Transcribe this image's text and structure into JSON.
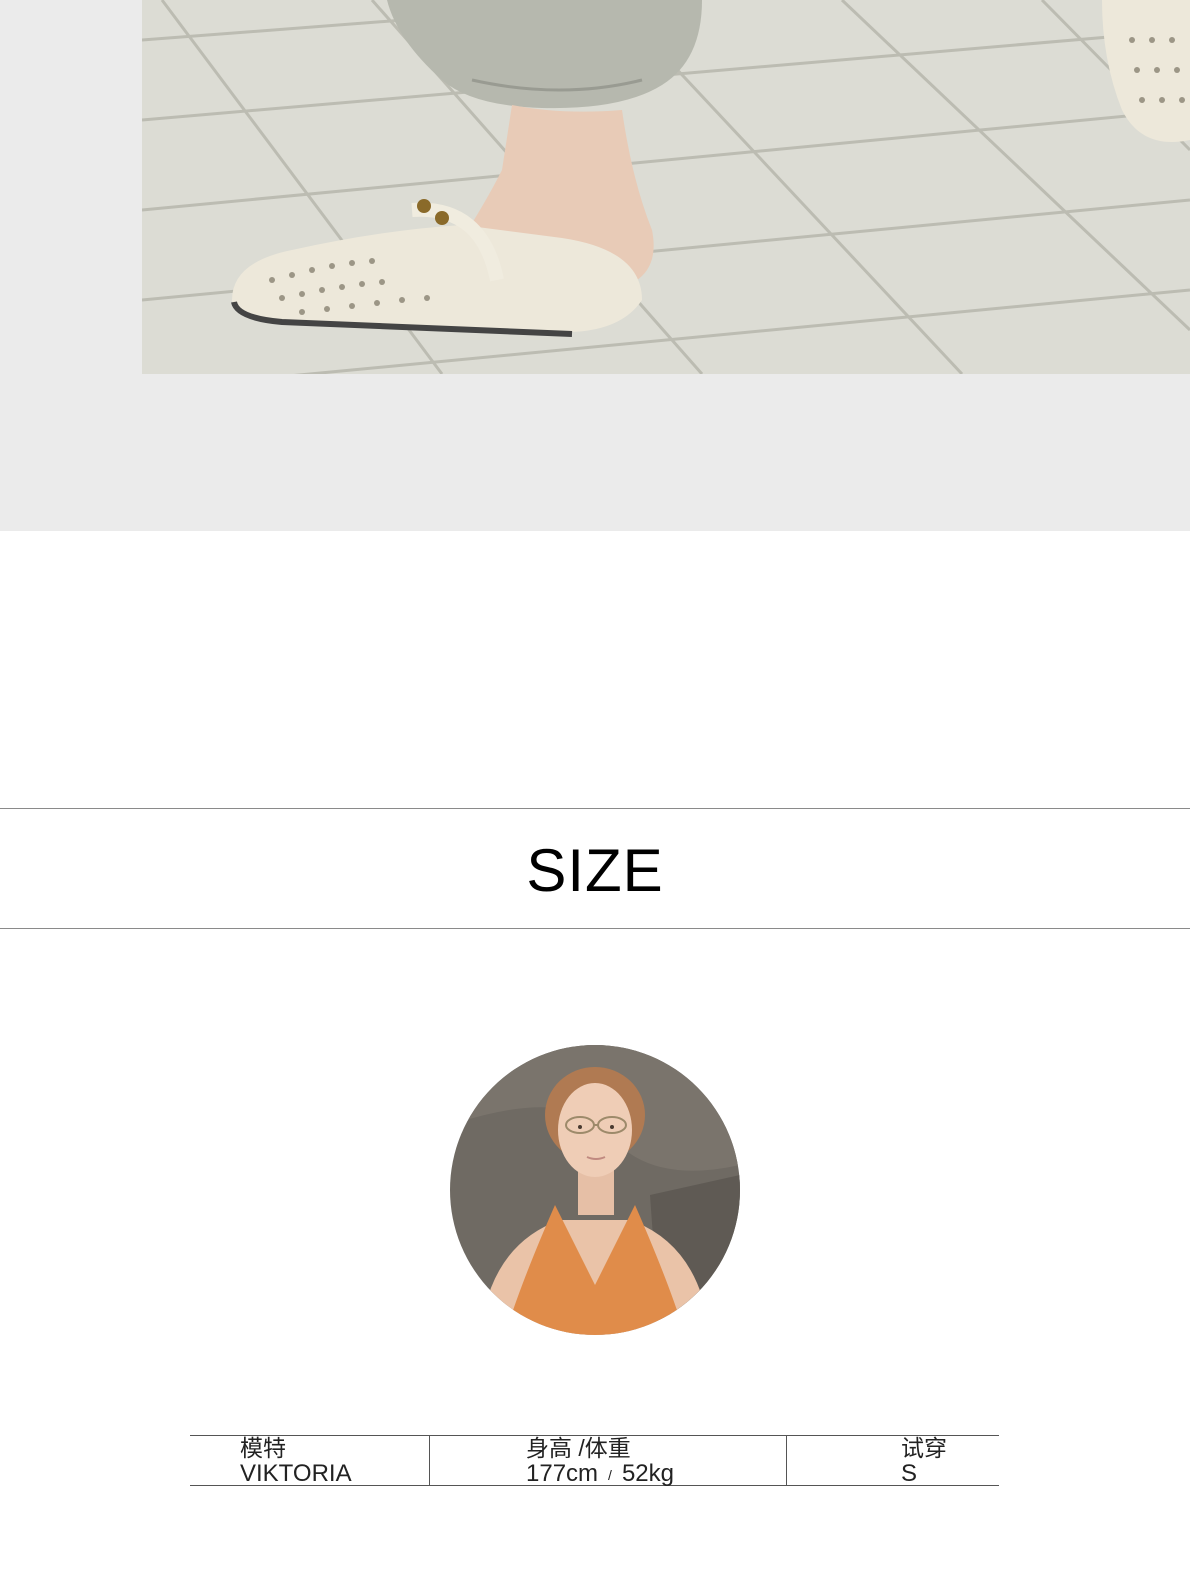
{
  "size_section": {
    "title": "SIZE"
  },
  "model_table": {
    "headers": {
      "model": "模特",
      "height_weight": "身高 /体重",
      "try_on": "试穿"
    },
    "values": {
      "model": "VIKTORIA",
      "height": "177cm",
      "separator": "/",
      "weight": "52kg",
      "try_on": "S"
    }
  },
  "colors": {
    "band": "#ebebeb",
    "rule": "#8a8a8a",
    "top": "#e08c4a"
  }
}
